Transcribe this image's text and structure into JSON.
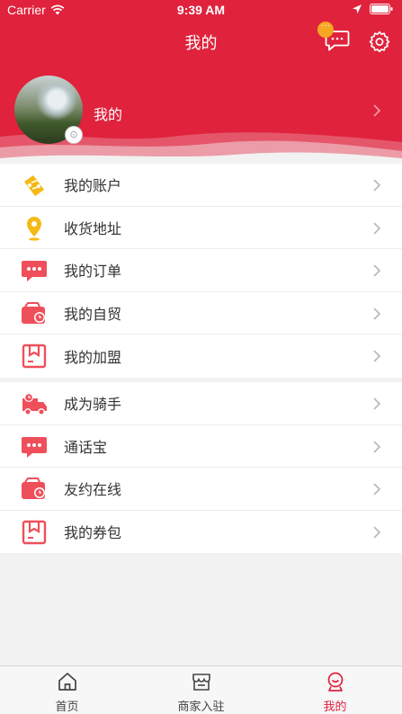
{
  "status_bar": {
    "carrier": "Carrier",
    "time": "9:39 AM"
  },
  "header": {
    "title": "我的",
    "message_badge": "···"
  },
  "profile": {
    "name": "我的"
  },
  "menu_group_1": [
    {
      "label": "我的账户",
      "icon": "ticket-icon"
    },
    {
      "label": "收货地址",
      "icon": "location-pin-icon"
    },
    {
      "label": "我的订单",
      "icon": "chat-bubble-icon"
    },
    {
      "label": "我的自贸",
      "icon": "wallet-clock-icon"
    },
    {
      "label": "我的加盟",
      "icon": "box-icon"
    }
  ],
  "menu_group_2": [
    {
      "label": "成为骑手",
      "icon": "delivery-truck-icon"
    },
    {
      "label": "通话宝",
      "icon": "chat-bubble-icon"
    },
    {
      "label": "友约在线",
      "icon": "wallet-clock-icon"
    },
    {
      "label": "我的券包",
      "icon": "box-icon"
    }
  ],
  "tabbar": [
    {
      "label": "首页",
      "icon": "home-icon",
      "active": false
    },
    {
      "label": "商家入驻",
      "icon": "store-icon",
      "active": false
    },
    {
      "label": "我的",
      "icon": "user-face-icon",
      "active": true
    }
  ],
  "colors": {
    "brand_red": "#e0223c",
    "icon_red": "#ef4f5a",
    "icon_yellow": "#f5b914",
    "badge_orange": "#f5a623"
  }
}
